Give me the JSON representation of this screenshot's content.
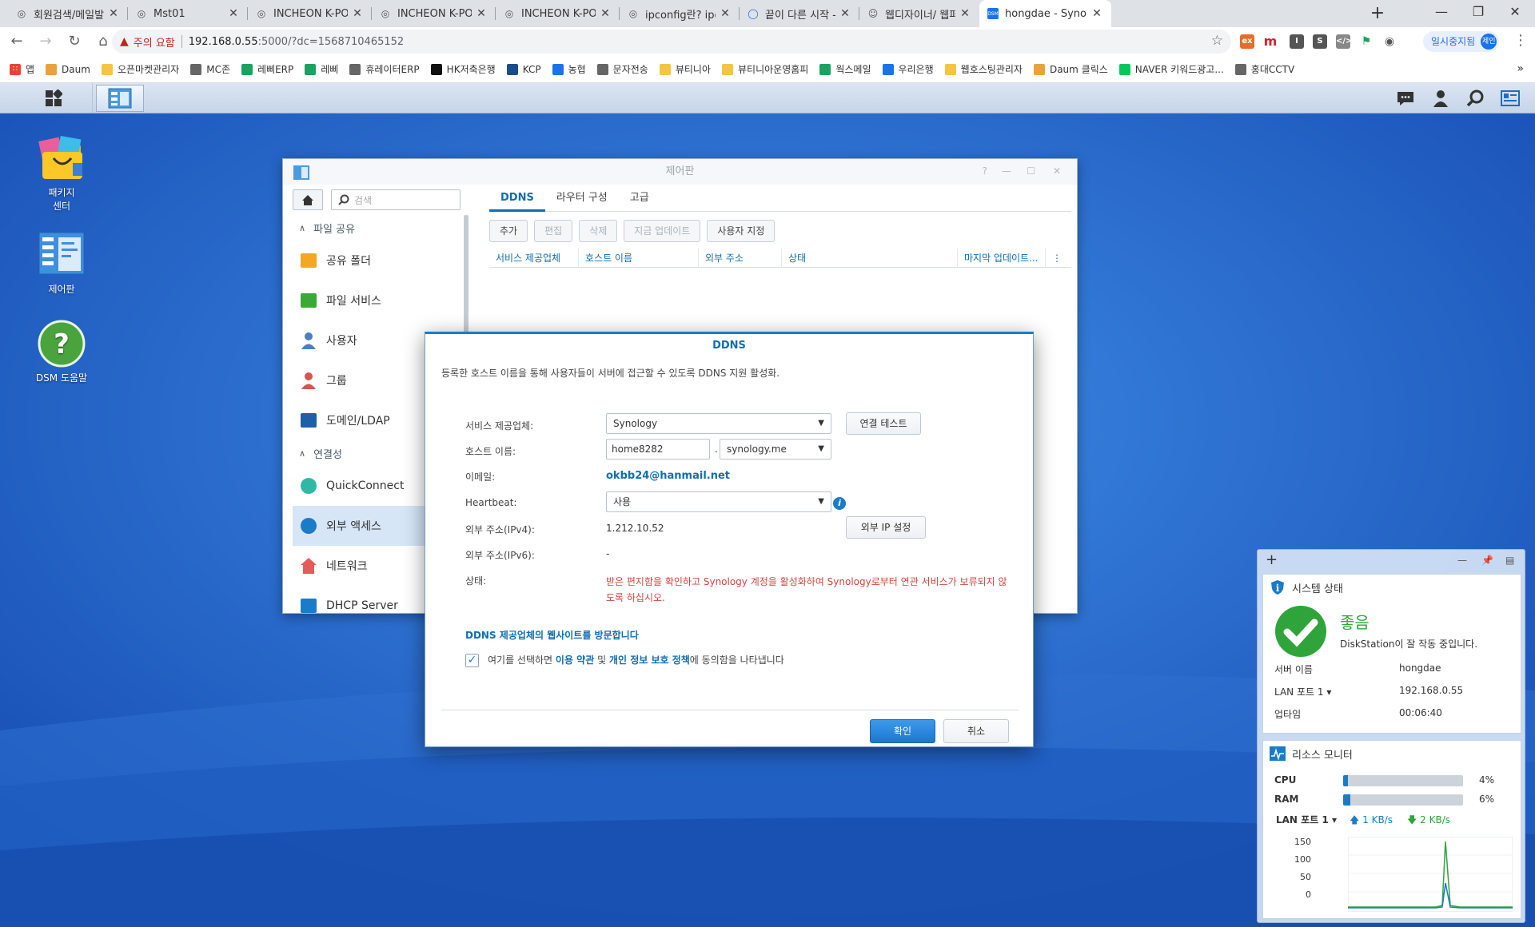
{
  "browser": {
    "tabs": [
      {
        "title": "회원검색/메일발송",
        "icon": "globe-icon"
      },
      {
        "title": "Mst01",
        "icon": "globe-icon"
      },
      {
        "title": "INCHEON K-POP CON",
        "icon": "globe-icon"
      },
      {
        "title": "INCHEON K-POP CON",
        "icon": "globe-icon"
      },
      {
        "title": "INCHEON K-POP CON",
        "icon": "globe-icon"
      },
      {
        "title": "ipconfig란? ipconfig 명",
        "icon": "globe-icon"
      },
      {
        "title": "끝이 다른 시작 - 잡코",
        "icon": "chat-icon"
      },
      {
        "title": "웹디자이너/ 웹퍼블리",
        "icon": "person-icon"
      },
      {
        "title": "hongdae - Synology D",
        "icon": "dsm-icon"
      }
    ],
    "security_warning": "주의 요함",
    "url_host": "192.168.0.55",
    "url_rest": ":5000/?dc=1568710465152",
    "sync_label": "일시중지됨",
    "profile_initial": "제인",
    "bookmarks": [
      {
        "label": "앱",
        "color": "#e84435"
      },
      {
        "label": "Daum",
        "color": "#e7a43b"
      },
      {
        "label": "오픈마켓관리자",
        "color": "#f4c542"
      },
      {
        "label": "MC존",
        "color": "#666666"
      },
      {
        "label": "레삐ERP",
        "color": "#1aa260"
      },
      {
        "label": "레삐",
        "color": "#1aa260"
      },
      {
        "label": "휴레이터ERP",
        "color": "#666666"
      },
      {
        "label": "HK저축은행",
        "color": "#111111"
      },
      {
        "label": "KCP",
        "color": "#1a4c8c"
      },
      {
        "label": "농협",
        "color": "#1a73e8"
      },
      {
        "label": "문자전송",
        "color": "#666666"
      },
      {
        "label": "뷰티니아",
        "color": "#f4c542"
      },
      {
        "label": "뷰티니아운영홈피",
        "color": "#f4c542"
      },
      {
        "label": "웍스메일",
        "color": "#1aa260"
      },
      {
        "label": "우리은행",
        "color": "#1a73e8"
      },
      {
        "label": "웹호스팅관리자",
        "color": "#f4c542"
      },
      {
        "label": "Daum 클릭스",
        "color": "#e7a43b"
      },
      {
        "label": "NAVER 키워드광고...",
        "color": "#03c75a"
      },
      {
        "label": "홍대CCTV",
        "color": "#666666"
      }
    ]
  },
  "desktop": {
    "icons": [
      {
        "label": "패키지\n센터"
      },
      {
        "label": "제어판"
      },
      {
        "label": "DSM 도움말"
      }
    ]
  },
  "control_panel": {
    "title": "제어판",
    "search_placeholder": "검색",
    "sidebar": [
      {
        "type": "group",
        "label": "파일 공유"
      },
      {
        "type": "item",
        "label": "공유 폴더",
        "icon": "folder-share-icon"
      },
      {
        "type": "item",
        "label": "파일 서비스",
        "icon": "file-services-icon"
      },
      {
        "type": "item",
        "label": "사용자",
        "icon": "user-icon"
      },
      {
        "type": "item",
        "label": "그룹",
        "icon": "group-icon"
      },
      {
        "type": "item",
        "label": "도메인/LDAP",
        "icon": "domain-icon"
      },
      {
        "type": "group",
        "label": "연결성"
      },
      {
        "type": "item",
        "label": "QuickConnect",
        "icon": "quickconnect-icon"
      },
      {
        "type": "item",
        "label": "외부 액세스",
        "icon": "globe-icon",
        "selected": true
      },
      {
        "type": "item",
        "label": "네트워크",
        "icon": "network-icon"
      },
      {
        "type": "item",
        "label": "DHCP Server",
        "icon": "dhcp-icon"
      }
    ],
    "tabs": [
      "DDNS",
      "라우터 구성",
      "고급"
    ],
    "toolbar": [
      {
        "label": "추가",
        "disabled": false
      },
      {
        "label": "편집",
        "disabled": true
      },
      {
        "label": "삭제",
        "disabled": true
      },
      {
        "label": "지금 업데이트",
        "disabled": true
      },
      {
        "label": "사용자 지정",
        "disabled": false
      }
    ],
    "columns": [
      "서비스 제공업체",
      "호스트 이름",
      "외부 주소",
      "상태",
      "마지막 업데이트..."
    ]
  },
  "ddns_dialog": {
    "title": "DDNS",
    "description": "등록한 호스트 이름을 통해 사용자들이 서버에 접근할 수 있도록 DDNS 지원 활성화.",
    "provider_label": "서비스 제공업체:",
    "provider_value": "Synology",
    "test_button": "연결 테스트",
    "hostname_label": "호스트 이름:",
    "hostname_value": "home8282",
    "domain_value": "synology.me",
    "email_label": "이메일:",
    "email_value": "okbb24@hanmail.net",
    "heartbeat_label": "Heartbeat:",
    "heartbeat_value": "사용",
    "ipv4_label": "외부 주소(IPv4):",
    "ipv4_value": "1.212.10.52",
    "set_ip_button": "외부 IP 설정",
    "ipv6_label": "외부 주소(IPv6):",
    "ipv6_value": "-",
    "status_label": "상태:",
    "status_value": "받은 편지함을 확인하고 Synology 계정을 활성화하여 Synology로부터 연관 서비스가 보류되지 않도록 하십시오.",
    "provider_link": "DDNS 제공업체의 웹사이트를 방문합니다",
    "agree_pre": "여기를 선택하면 ",
    "agree_terms": "이용 약관",
    "agree_mid": " 및 ",
    "agree_privacy": "개인 정보 보호 정책",
    "agree_post": "에 동의함을 나타냅니다",
    "agree_checked": true,
    "ok_button": "확인",
    "cancel_button": "취소"
  },
  "widgets": {
    "system_title": "시스템 상태",
    "system_status": "좋음",
    "system_message": "DiskStation이 잘 작동 중입니다.",
    "server_name_label": "서버 이름",
    "server_name_value": "hongdae",
    "lan_label": "LAN 포트 1",
    "lan_value": "192.168.0.55",
    "uptime_label": "업타임",
    "uptime_value": "00:06:40",
    "resource_title": "리소스 모니터",
    "cpu_label": "CPU",
    "cpu_value": "4%",
    "cpu_percent": 4,
    "ram_label": "RAM",
    "ram_value": "6%",
    "ram_percent": 6,
    "net_label": "LAN 포트 1",
    "net_up": "1 KB/s",
    "net_down": "2 KB/s",
    "chart_ticks": [
      "150",
      "100",
      "50",
      "0"
    ]
  }
}
